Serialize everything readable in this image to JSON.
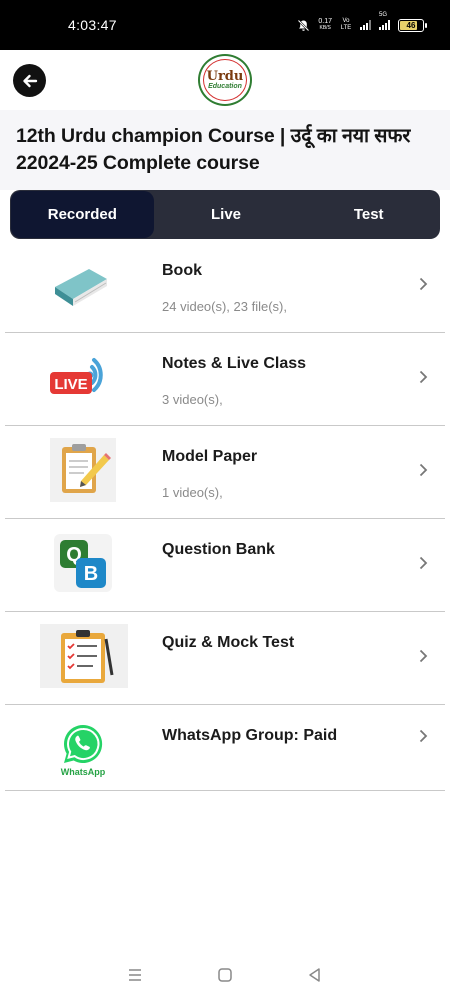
{
  "status_bar": {
    "time": "4:03:47",
    "net_speed": "0.17",
    "net_unit": "KB/S",
    "volte": "Vo LTE",
    "net_type": "5G",
    "battery": "46"
  },
  "header": {
    "back_icon": "arrow-left-icon",
    "logo_line1": "Urdu",
    "logo_line2": "Education"
  },
  "course": {
    "title": "12th Urdu champion Course | उर्दू का नया सफर 22024-25 Complete course"
  },
  "tabs": [
    {
      "label": "Recorded",
      "active": true
    },
    {
      "label": "Live",
      "active": false
    },
    {
      "label": "Test",
      "active": false
    }
  ],
  "items": [
    {
      "label": "Book",
      "sub": "24 video(s), 23 file(s),",
      "icon": "book-icon"
    },
    {
      "label": "Notes & Live Class",
      "sub": "3 video(s),",
      "icon": "live-icon",
      "icon_text": "LIVE"
    },
    {
      "label": "Model Paper",
      "sub": "1 video(s),",
      "icon": "clipboard-pencil-icon"
    },
    {
      "label": "Question Bank",
      "sub": "",
      "icon": "qb-blocks-icon",
      "icon_text_q": "Q",
      "icon_text_b": "B"
    },
    {
      "label": "Quiz & Mock Test",
      "sub": "",
      "icon": "checklist-icon"
    },
    {
      "label": "WhatsApp Group: Paid",
      "sub": "",
      "icon": "whatsapp-icon",
      "icon_text": "WhatsApp"
    }
  ],
  "colors": {
    "tab_bar": "#2a2d3a",
    "tab_active": "#0f1631",
    "live_red": "#e53935",
    "whatsapp_green": "#25d366"
  }
}
